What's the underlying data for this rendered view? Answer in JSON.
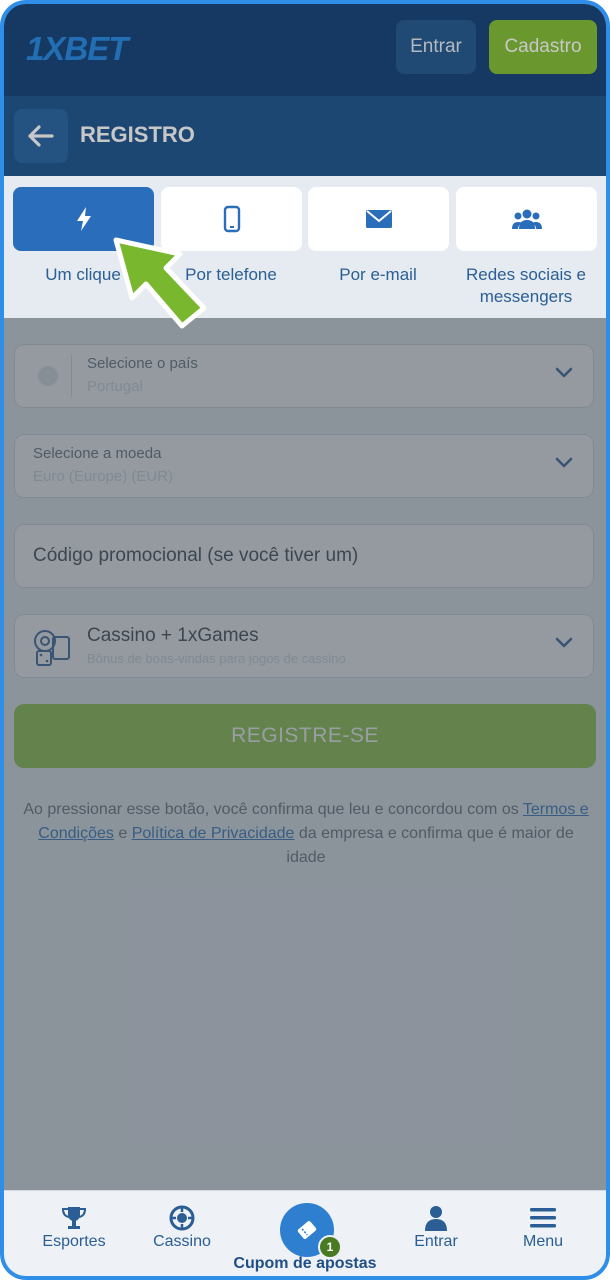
{
  "header": {
    "logo_text": "1XBET",
    "login_label": "Entrar",
    "signup_label": "Cadastro"
  },
  "subheader": {
    "title": "REGISTRO"
  },
  "tabs": [
    {
      "label": "Um clique",
      "icon": "lightning-icon",
      "active": true
    },
    {
      "label": "Por telefone",
      "icon": "phone-icon",
      "active": false
    },
    {
      "label": "Por e-mail",
      "icon": "envelope-icon",
      "active": false
    },
    {
      "label": "Redes sociais e messengers",
      "icon": "users-icon",
      "active": false
    }
  ],
  "form": {
    "country_label": "Selecione o país",
    "country_value": "Portugal",
    "currency_label": "Selecione a moeda",
    "currency_value": "Euro (Europe) (EUR)",
    "promo_placeholder": "Código promocional (se você tiver um)",
    "bonus_title": "Cassino + 1xGames",
    "bonus_desc": "Bônus de boas-vindas para jogos de cassino",
    "register_label": "REGISTRE-SE"
  },
  "legal": {
    "text_1": "Ao pressionar esse botão, você confirma que leu e concordou com os ",
    "link_terms": "Termos e Condições",
    "text_2": " e ",
    "link_privacy": "Política de Privacidade",
    "text_3": " da empresa e confirma que é maior de idade"
  },
  "bottom_nav": {
    "items": [
      {
        "label": "Esportes",
        "icon": "trophy-icon"
      },
      {
        "label": "Cassino",
        "icon": "casino-chip-icon"
      },
      {
        "label": "Entrar",
        "icon": "user-icon"
      },
      {
        "label": "Menu",
        "icon": "hamburger-icon"
      }
    ],
    "center_label": "Cupom de apostas",
    "badge_count": "1"
  },
  "colors": {
    "brand_blue": "#2a6dba",
    "header_blue": "#1b4a7e",
    "accent_green": "#88c33c",
    "pointer_green": "#79b82e"
  }
}
